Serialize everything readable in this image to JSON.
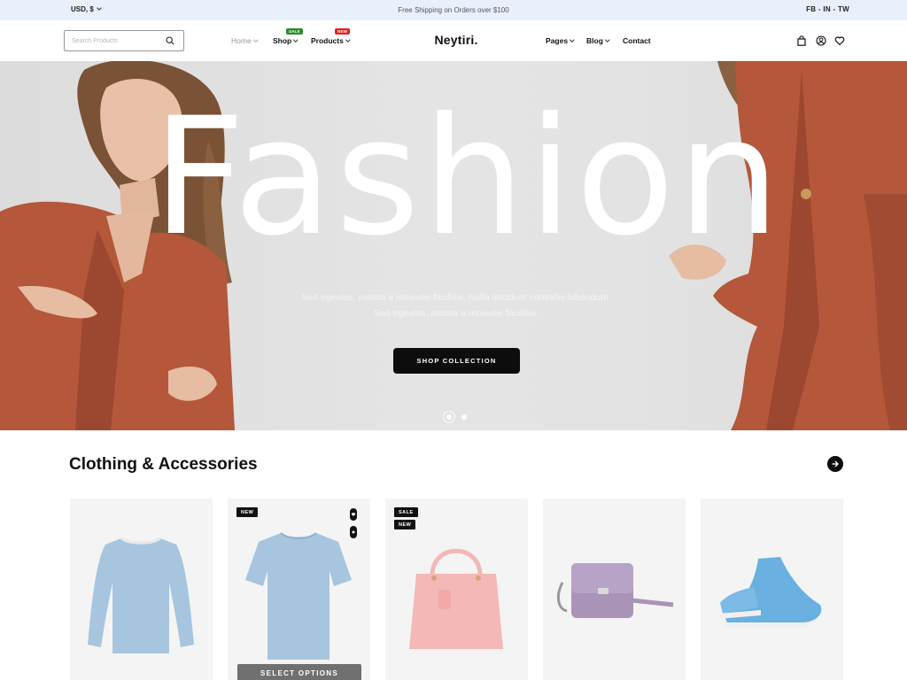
{
  "topbar": {
    "currency": "USD, $",
    "shipping": "Free Shipping on Orders over $100",
    "socials": "FB - IN - TW"
  },
  "header": {
    "search_placeholder": "Search Products",
    "logo": "Neytiri.",
    "nav_left": [
      {
        "label": "Home",
        "badge": ""
      },
      {
        "label": "Shop",
        "badge": "SALE"
      },
      {
        "label": "Products",
        "badge": "NEW"
      }
    ],
    "nav_right": [
      {
        "label": "Pages"
      },
      {
        "label": "Blog"
      },
      {
        "label": "Contact"
      }
    ],
    "icons": [
      "bag-icon",
      "user-icon",
      "heart-icon"
    ]
  },
  "hero": {
    "title": "Fashion",
    "subtitle_line1": "Sed egestas, massa a molestie facilisis. Nulla tincidunt convallis bibendum.",
    "subtitle_line2": "Sed egestas, massa a molestie facilisis.",
    "button": "SHOP COLLECTION",
    "slides": 2,
    "active_slide": 1
  },
  "section": {
    "title": "Clothing & Accessories"
  },
  "products": [
    {
      "image": "long-sleeve-shirt",
      "badges": []
    },
    {
      "image": "t-shirt",
      "badges": [
        "NEW"
      ],
      "button": "SELECT OPTIONS"
    },
    {
      "image": "pink-handbag",
      "badges": [
        "SALE",
        "NEW"
      ]
    },
    {
      "image": "purple-crossbody-bag",
      "badges": []
    },
    {
      "image": "blue-sneakers",
      "badges": []
    }
  ],
  "colors": {
    "topbar_bg": "#e8f1fb",
    "sale_badge": "#2a8a2a",
    "new_badge": "#e02020",
    "button_dark": "#0d0d0d",
    "jacket": "#b5573a",
    "shirt_blue": "#a7c5df"
  }
}
